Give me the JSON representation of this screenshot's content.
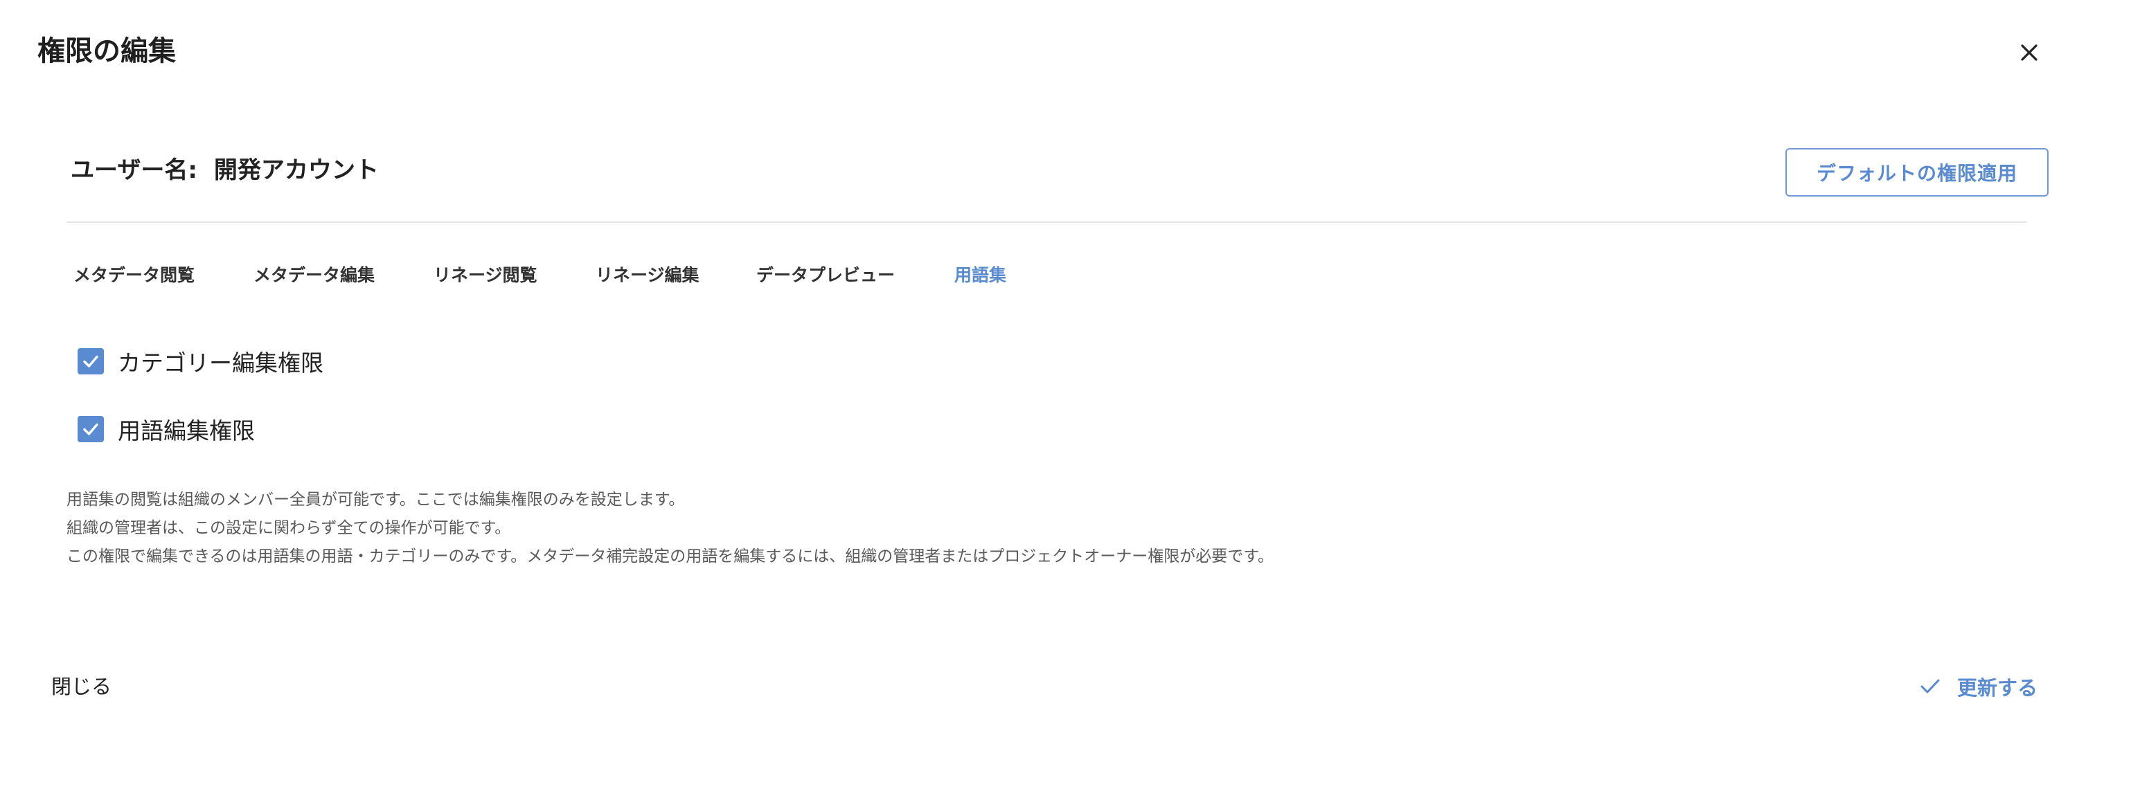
{
  "dialog": {
    "title": "権限の編集",
    "close_icon": "close-icon"
  },
  "user": {
    "label": "ユーザー名:",
    "name": "開発アカウント"
  },
  "default_button": {
    "label": "デフォルトの権限適用"
  },
  "tabs": [
    {
      "label": "メタデータ閲覧",
      "active": false
    },
    {
      "label": "メタデータ編集",
      "active": false
    },
    {
      "label": "リネージ閲覧",
      "active": false
    },
    {
      "label": "リネージ編集",
      "active": false
    },
    {
      "label": "データプレビュー",
      "active": false
    },
    {
      "label": "用語集",
      "active": true
    }
  ],
  "permissions": [
    {
      "label": "カテゴリー編集権限",
      "checked": true
    },
    {
      "label": "用語編集権限",
      "checked": true
    }
  ],
  "notes": [
    "用語集の閲覧は組織のメンバー全員が可能です。ここでは編集権限のみを設定します。",
    "組織の管理者は、この設定に関わらず全ての操作が可能です。",
    "この権限で編集できるのは用語集の用語・カテゴリーのみです。メタデータ補完設定の用語を編集するには、組織の管理者またはプロジェクトオーナー権限が必要です。"
  ],
  "footer": {
    "close_label": "閉じる",
    "update_label": "更新する",
    "update_icon": "check-icon"
  },
  "colors": {
    "accent": "#5a8bd0",
    "text": "#222222",
    "muted_text": "#5a5a5a",
    "divider": "#e3e3e3"
  }
}
